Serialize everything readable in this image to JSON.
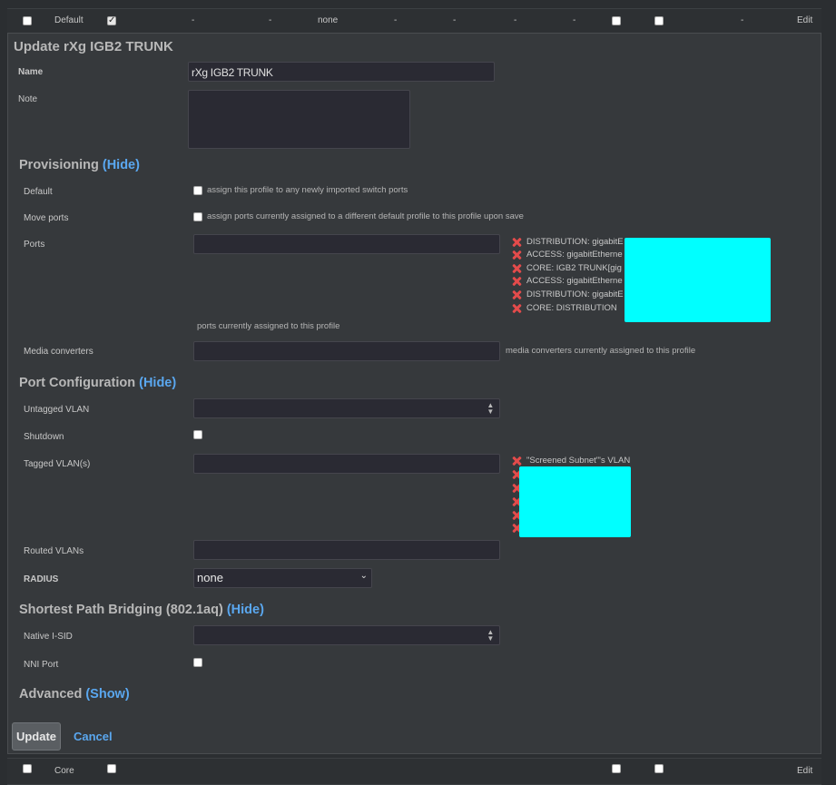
{
  "top_row": {
    "name": "Default",
    "cols": [
      "-",
      "-",
      "none",
      "-",
      "-",
      "-",
      "-",
      "-",
      "-"
    ],
    "edit_label": "Edit"
  },
  "bottom_row": {
    "name": "Core",
    "edit_label": "Edit"
  },
  "form": {
    "title": "Update rXg IGB2 TRUNK",
    "name_label": "Name",
    "name_value": "rXg IGB2 TRUNK",
    "note_label": "Note",
    "note_value": ""
  },
  "provisioning": {
    "title": "Provisioning",
    "toggle": "(Hide)",
    "default_label": "Default",
    "default_hint": "assign this profile to any newly imported switch ports",
    "move_label": "Move ports",
    "move_hint": "assign ports currently assigned to a different default profile to this profile upon save",
    "ports_label": "Ports",
    "ports": [
      "DISTRIBUTION: gigabitE",
      "ACCESS: gigabitEtherne",
      "CORE: IGB2 TRUNK[gig",
      "ACCESS: gigabitEtherne",
      "DISTRIBUTION: gigabitE",
      "CORE: DISTRIBUTION"
    ],
    "ports_hint": "ports currently assigned to this profile",
    "media_label": "Media converters",
    "media_hint": "media converters currently assigned to this profile"
  },
  "port_config": {
    "title": "Port Configuration",
    "toggle": "(Hide)",
    "untagged_label": "Untagged VLAN",
    "shutdown_label": "Shutdown",
    "tagged_label": "Tagged VLAN(s)",
    "tagged_vlans": [
      "\"Screened Subnet\"'s VLAN",
      "",
      "",
      "",
      "",
      ""
    ],
    "routed_label": "Routed VLANs",
    "radius_label": "RADIUS",
    "radius_value": "none"
  },
  "spb": {
    "title": "Shortest Path Bridging (802.1aq)",
    "toggle": "(Hide)",
    "isid_label": "Native I-SID",
    "nni_label": "NNI Port"
  },
  "advanced": {
    "title": "Advanced",
    "toggle": "(Show)"
  },
  "actions": {
    "update_label": "Update",
    "cancel_label": "Cancel"
  },
  "colors": {
    "accent_link": "#5aa7ef",
    "remove_icon": "#e34b4b",
    "redaction": "#00ffff"
  }
}
